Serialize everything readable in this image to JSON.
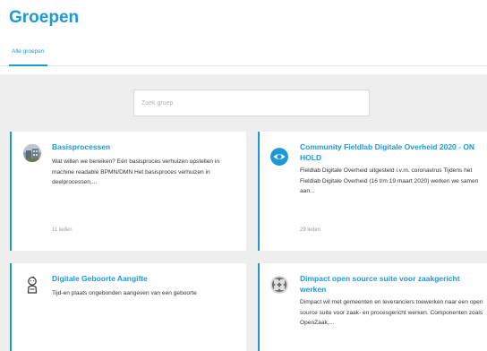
{
  "page": {
    "title": "Groepen"
  },
  "tabs": [
    {
      "label": "Alle groepen"
    }
  ],
  "search": {
    "placeholder": "Zoek groep"
  },
  "groups": [
    {
      "title": "Basisprocessen",
      "description": "Wat willen we bereiken? Eén basisproces verhuizen opstellen in machine readable BPMN/DMN Het basisproces verhuizen in deelprocessen,...",
      "members": "11 leden",
      "icon": "building-photo-icon"
    },
    {
      "title": "Community Fieldlab Digitale Overheid 2020 - ON HOLD",
      "description": "Fieldlab Digitale Overheid uitgesteld i.v.m. coronavirus Tijdens het Fieldlab Digitale Overheid (16 t/m 19 maart 2020) werken we samen aan...",
      "members": "29 leden",
      "icon": "eye-logo-icon"
    },
    {
      "title": "Digitale Geboorte Aangifte",
      "description": "Tijd-en plaats ongebonden aangeven van een geboorte",
      "members": "",
      "icon": "baby-icon"
    },
    {
      "title": "Dimpact open source suite voor zaakgericht werken",
      "description": "Dimpact wil met gemeenten en leveranciers toewerken naar een open source suite voor zaak- en procesgericht werken. Componenten zoals OpenZaak,...",
      "members": "",
      "icon": "puzzle-avatar-icon"
    }
  ],
  "colors": {
    "accent": "#1c9ad6",
    "background": "#eeeeee"
  }
}
